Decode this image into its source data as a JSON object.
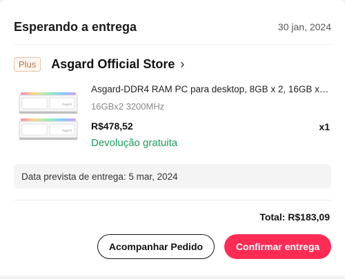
{
  "order": {
    "status": "Esperando a entrega",
    "date": "30 jan, 2024"
  },
  "store": {
    "badge": "Plus",
    "name": "Asgard Official Store",
    "chevron": "›"
  },
  "product": {
    "title": "Asgard-DDR4 RAM PC para desktop, 8GB x 2, 16GB x 2,...",
    "variant": "16GBx2 3200MHz",
    "price": "R$478,52",
    "quantity": "x1",
    "return_policy": "Devolução gratuita",
    "image_icon": "ram-module-icon",
    "image_brand": "Asgard"
  },
  "delivery": {
    "estimate": "Data prevista de entrega: 5 mar, 2024"
  },
  "summary": {
    "total": "Total: R$183,09"
  },
  "actions": {
    "track": "Acompanhar Pedido",
    "confirm": "Confirmar entrega"
  },
  "colors": {
    "accent": "#fe2c55",
    "return_green": "#17a05d",
    "badge_text": "#b5754b"
  }
}
